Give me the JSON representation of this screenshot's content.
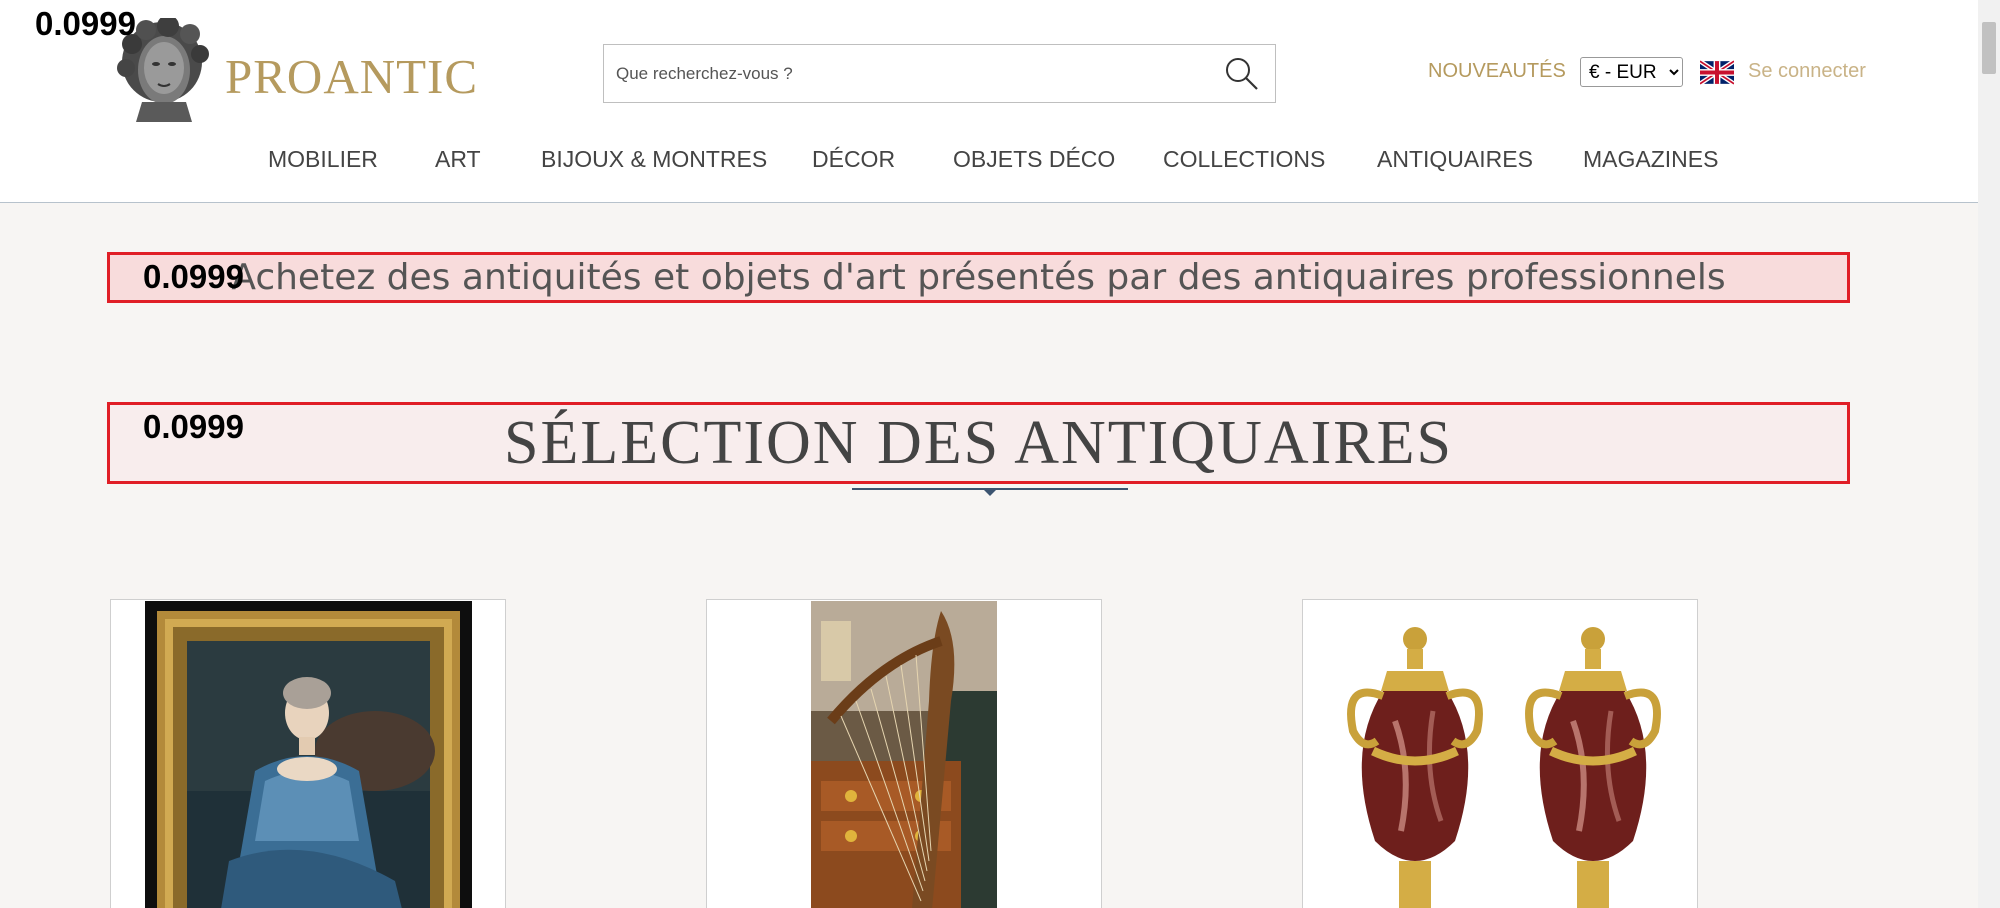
{
  "scores": {
    "top": "0.0999",
    "tagline": "0.0999",
    "title": "0.0999"
  },
  "brand": {
    "name": "PROANTIC"
  },
  "search": {
    "placeholder": "Que recherchez-vous ?"
  },
  "header": {
    "new_label": "NOUVEAUTÉS",
    "currency_selected": "€ - EUR",
    "login_label": "Se connecter",
    "flag_icon": "uk-flag-icon"
  },
  "nav": {
    "items": [
      {
        "label": "MOBILIER"
      },
      {
        "label": "ART"
      },
      {
        "label": "BIJOUX & MONTRES"
      },
      {
        "label": "DÉCOR"
      },
      {
        "label": "OBJETS DÉCO"
      },
      {
        "label": "COLLECTIONS"
      },
      {
        "label": "ANTIQUAIRES"
      },
      {
        "label": "MAGAZINES"
      }
    ]
  },
  "main": {
    "tagline": "Achetez des antiquités et objets d'art présentés par des antiquaires professionnels",
    "section_title": "SÉLECTION DES ANTIQUAIRES"
  },
  "products": [
    {
      "image": "portrait-painting"
    },
    {
      "image": "harp-and-commode"
    },
    {
      "image": "pair-of-marble-vases"
    }
  ],
  "colors": {
    "gold": "#b59a5e",
    "highlight_border": "#e01e26",
    "rule": "#3c5470"
  }
}
